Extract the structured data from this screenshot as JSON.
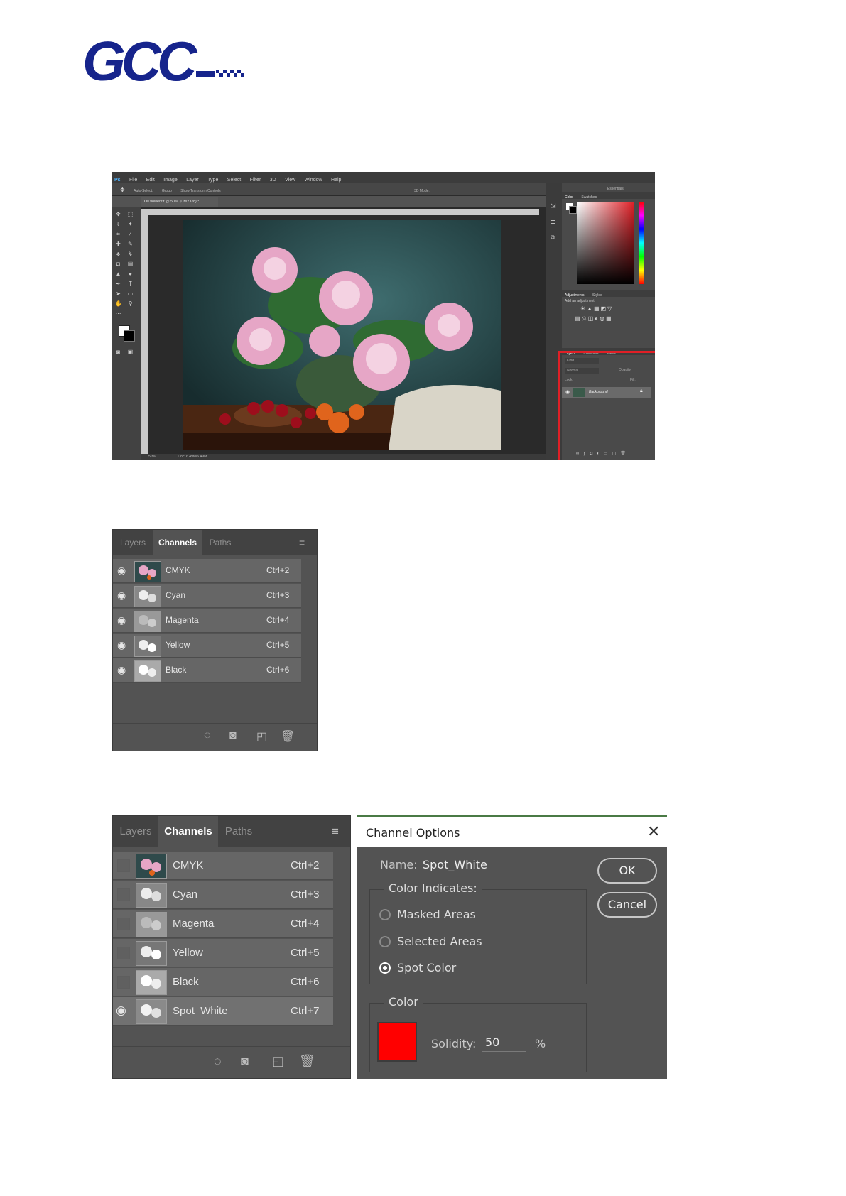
{
  "logo": {
    "text": "GCC",
    "color": "#16248c"
  },
  "photoshop": {
    "logo": "Ps",
    "menu": [
      "File",
      "Edit",
      "Image",
      "Layer",
      "Type",
      "Select",
      "Filter",
      "3D",
      "View",
      "Window",
      "Help"
    ],
    "options": [
      "Auto-Select:",
      "Group",
      "Show Transform Controls",
      "3D Mode:",
      "Essentials"
    ],
    "doc_tab": "Oil flower.tif @ 50% (CMYK/8) *",
    "status_zoom": "50%",
    "status_doc": "Doc: 6.49M/6.49M",
    "color_panel": {
      "tabs": [
        "Color",
        "Swatches"
      ]
    },
    "adjustments_panel": {
      "tabs": [
        "Adjustments",
        "Styles"
      ],
      "hint": "Add an adjustment"
    },
    "layers_panel": {
      "tabs": [
        "Layers",
        "Channels",
        "Paths"
      ],
      "kind": "Kind",
      "blend": "Normal",
      "opacity": "Opacity:",
      "fill": "Fill:",
      "lock": "Lock:",
      "layer": "Background"
    },
    "highlight_color": "#e01f26"
  },
  "panel1": {
    "tabs": [
      "Layers",
      "Channels",
      "Paths"
    ],
    "active_tab": "Channels",
    "rows": [
      {
        "name": "CMYK",
        "shortcut": "Ctrl+2",
        "visible": true
      },
      {
        "name": "Cyan",
        "shortcut": "Ctrl+3",
        "visible": true
      },
      {
        "name": "Magenta",
        "shortcut": "Ctrl+4",
        "visible": true
      },
      {
        "name": "Yellow",
        "shortcut": "Ctrl+5",
        "visible": true
      },
      {
        "name": "Black",
        "shortcut": "Ctrl+6",
        "visible": true
      }
    ],
    "footer_icons": [
      "load-selection-icon",
      "save-selection-icon",
      "new-channel-icon",
      "trash-icon"
    ]
  },
  "panel2": {
    "tabs": [
      "Layers",
      "Channels",
      "Paths"
    ],
    "active_tab": "Channels",
    "rows": [
      {
        "name": "CMYK",
        "shortcut": "Ctrl+2",
        "visible": false
      },
      {
        "name": "Cyan",
        "shortcut": "Ctrl+3",
        "visible": false
      },
      {
        "name": "Magenta",
        "shortcut": "Ctrl+4",
        "visible": false
      },
      {
        "name": "Yellow",
        "shortcut": "Ctrl+5",
        "visible": false
      },
      {
        "name": "Black",
        "shortcut": "Ctrl+6",
        "visible": false
      },
      {
        "name": "Spot_White",
        "shortcut": "Ctrl+7",
        "visible": true
      }
    ],
    "footer_icons": [
      "load-selection-icon",
      "save-selection-icon",
      "new-channel-icon",
      "trash-icon"
    ]
  },
  "dialog": {
    "title": "Channel Options",
    "name_label": "Name:",
    "name_value": "Spot_White",
    "indicates_label": "Color Indicates:",
    "options": [
      "Masked Areas",
      "Selected Areas",
      "Spot Color"
    ],
    "selected_option": "Spot Color",
    "color_label": "Color",
    "swatch_color": "#ff0000",
    "solidity_label": "Solidity:",
    "solidity_value": "50",
    "solidity_unit": "%",
    "ok": "OK",
    "cancel": "Cancel"
  }
}
